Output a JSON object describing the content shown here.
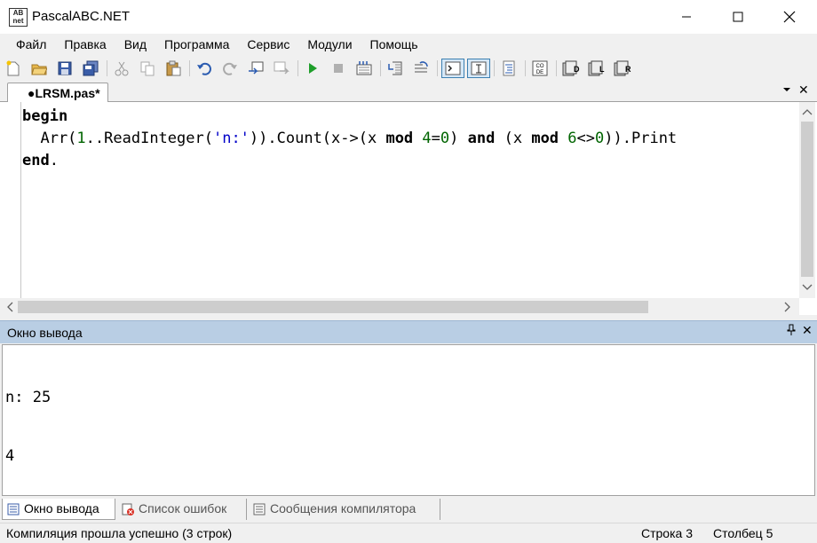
{
  "window": {
    "title": "PascalABC.NET",
    "icon_text": "AB\nnet"
  },
  "menu": [
    "Файл",
    "Правка",
    "Вид",
    "Программа",
    "Сервис",
    "Модули",
    "Помощь"
  ],
  "toolbar": {
    "icons": [
      "new-file-icon",
      "open-file-icon",
      "save-icon",
      "save-all-icon",
      "cut-icon",
      "copy-icon",
      "paste-icon",
      "undo-icon",
      "redo-icon",
      "navigate-back-icon",
      "navigate-forward-icon",
      "run-icon",
      "stop-icon",
      "debug-icon",
      "step-into-icon",
      "step-over-icon",
      "console-output-icon",
      "text-output-icon",
      "format-icon",
      "code-template-icon",
      "units-d-icon",
      "units-l-icon",
      "units-r-icon"
    ]
  },
  "document_tab": {
    "label": "●LRSM.pas*"
  },
  "editor": {
    "lines": [
      "begin",
      "  Arr(1..ReadInteger('n:')).Count(x->(x mod 4=0) and (x mod 6<>0)).Print",
      "end."
    ]
  },
  "output_panel": {
    "title": "Окно вывода",
    "lines": [
      "n: 25",
      "4"
    ]
  },
  "bottom_tabs": [
    {
      "label": "Окно вывода",
      "active": true
    },
    {
      "label": "Список ошибок",
      "active": false
    },
    {
      "label": "Сообщения компилятора",
      "active": false
    }
  ],
  "status": {
    "message": "Компиляция прошла успешно (3 строк)",
    "row_label": "Строка",
    "row_value": "3",
    "col_label": "Столбец",
    "col_value": "5"
  }
}
